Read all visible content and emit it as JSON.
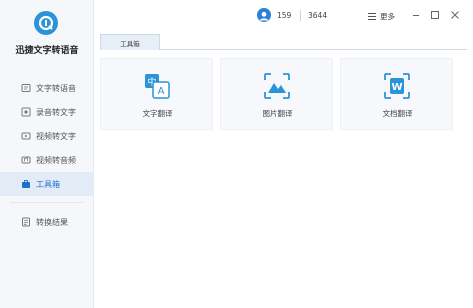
{
  "app": {
    "name": "迅捷文字转语音"
  },
  "sidebar": {
    "items": [
      {
        "label": "文字转语音"
      },
      {
        "label": "录音转文字"
      },
      {
        "label": "视频转文字"
      },
      {
        "label": "视频转音频"
      },
      {
        "label": "工具箱"
      }
    ],
    "bottom": {
      "label": "转换结果"
    }
  },
  "header": {
    "user_id": "159",
    "count": "3644",
    "menu_label": "更多"
  },
  "tabs": [
    {
      "label": "工具箱"
    }
  ],
  "cards": [
    {
      "label": "文字翻译",
      "icon": "text-translate-icon"
    },
    {
      "label": "图片翻译",
      "icon": "image-translate-icon"
    },
    {
      "label": "文档翻译",
      "icon": "document-translate-icon"
    }
  ],
  "colors": {
    "accent": "#1f6fd0",
    "icon_blue": "#2b94d8"
  }
}
